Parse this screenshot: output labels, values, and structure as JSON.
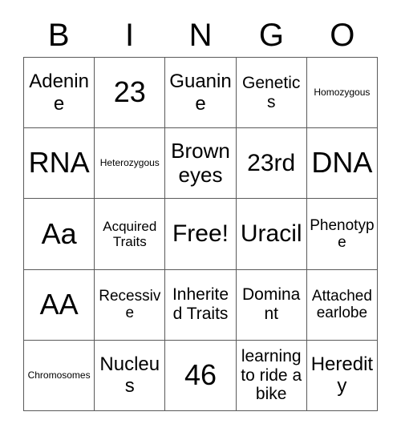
{
  "card": {
    "header": {
      "letters": [
        "B",
        "I",
        "N",
        "G",
        "O"
      ]
    },
    "grid": {
      "columns": 5,
      "rows": 5,
      "cells": [
        {
          "text": "Adenine",
          "size": "xl"
        },
        {
          "text": "23",
          "size": "4xl"
        },
        {
          "text": "Guanine",
          "size": "xl"
        },
        {
          "text": "Genetics",
          "size": "lg"
        },
        {
          "text": "Homozygous",
          "size": "xs"
        },
        {
          "text": "RNA",
          "size": "4xl"
        },
        {
          "text": "Heterozygous",
          "size": "xs"
        },
        {
          "text": "Brown eyes",
          "size": "2xl"
        },
        {
          "text": "23rd",
          "size": "3xl"
        },
        {
          "text": "DNA",
          "size": "4xl"
        },
        {
          "text": "Aa",
          "size": "4xl"
        },
        {
          "text": "Acquired Traits",
          "size": "sm"
        },
        {
          "text": "Free!",
          "size": "3xl"
        },
        {
          "text": "Uracil",
          "size": "3xl"
        },
        {
          "text": "Phenotype",
          "size": "md"
        },
        {
          "text": "AA",
          "size": "4xl"
        },
        {
          "text": "Recessive",
          "size": "md"
        },
        {
          "text": "Inherited Traits",
          "size": "lg"
        },
        {
          "text": "Dominant",
          "size": "lg"
        },
        {
          "text": "Attached earlobe",
          "size": "md"
        },
        {
          "text": "Chromosomes",
          "size": "xs"
        },
        {
          "text": "Nucleus",
          "size": "xl"
        },
        {
          "text": "46",
          "size": "4xl"
        },
        {
          "text": "learning to ride a bike",
          "size": "lg"
        },
        {
          "text": "Heredity",
          "size": "xl"
        }
      ]
    },
    "colors": {
      "background": "#ffffff",
      "text": "#000000",
      "border": "#5a5a5a"
    }
  }
}
